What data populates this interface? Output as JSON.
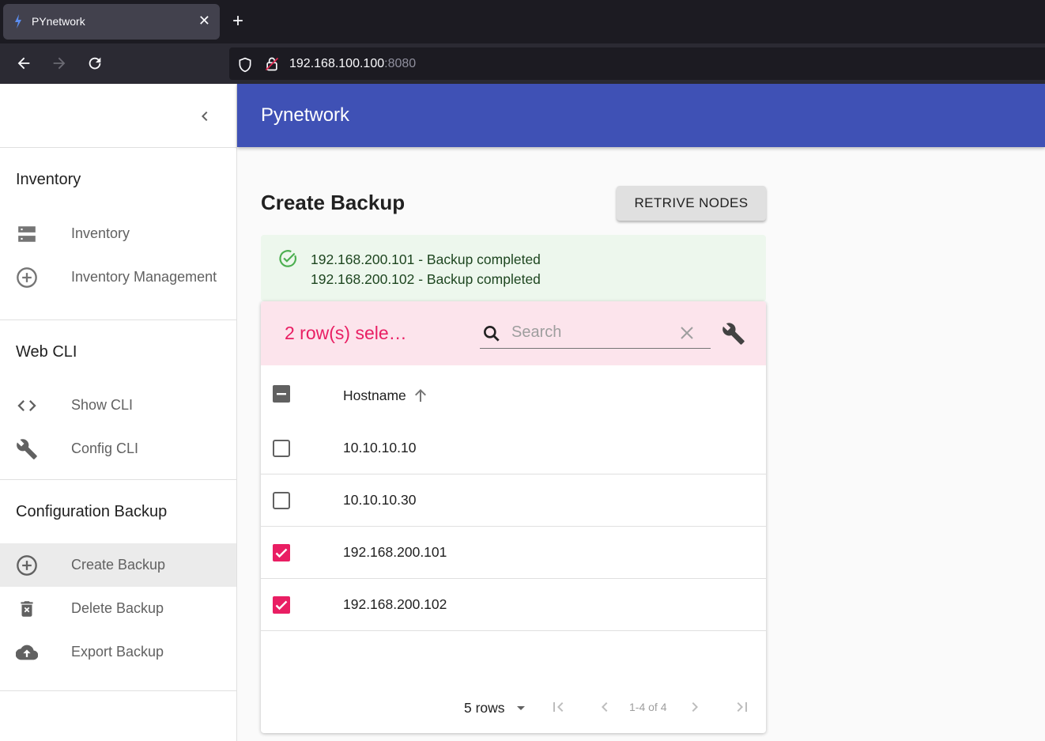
{
  "browser": {
    "tab_title": "PYnetwork",
    "url_host": "192.168.100.100",
    "url_port": ":8080"
  },
  "sidebar": {
    "sections": [
      {
        "title": "Inventory",
        "items": [
          {
            "label": "Inventory",
            "icon": "server-icon"
          },
          {
            "label": "Inventory Management",
            "icon": "add-circle-icon"
          }
        ]
      },
      {
        "title": "Web CLI",
        "items": [
          {
            "label": "Show CLI",
            "icon": "code-icon"
          },
          {
            "label": "Config CLI",
            "icon": "wrench-icon"
          }
        ]
      },
      {
        "title": "Configuration Backup",
        "items": [
          {
            "label": "Create Backup",
            "icon": "add-circle-icon",
            "active": true
          },
          {
            "label": "Delete Backup",
            "icon": "trash-icon"
          },
          {
            "label": "Export Backup",
            "icon": "cloud-upload-icon"
          }
        ]
      }
    ]
  },
  "header": {
    "title": "Pynetwork"
  },
  "main": {
    "page_title": "Create Backup",
    "retrive_button": "RETRIVE NODES",
    "alert": {
      "messages": [
        "192.168.200.101 - Backup completed",
        "192.168.200.102 - Backup completed"
      ]
    },
    "table": {
      "selected_text": "2 row(s) sele…",
      "search_placeholder": "Search",
      "column_header": "Hostname",
      "rows": [
        {
          "hostname": "10.10.10.10",
          "checked": false
        },
        {
          "hostname": "10.10.10.30",
          "checked": false
        },
        {
          "hostname": "192.168.200.101",
          "checked": true
        },
        {
          "hostname": "192.168.200.102",
          "checked": true
        }
      ],
      "rows_per_page": "5 rows",
      "range": "1-4 of 4"
    }
  },
  "colors": {
    "primary": "#3f51b5",
    "secondary": "#e91e63",
    "success_bg": "#edf7ed",
    "success_icon": "#4caf50"
  }
}
